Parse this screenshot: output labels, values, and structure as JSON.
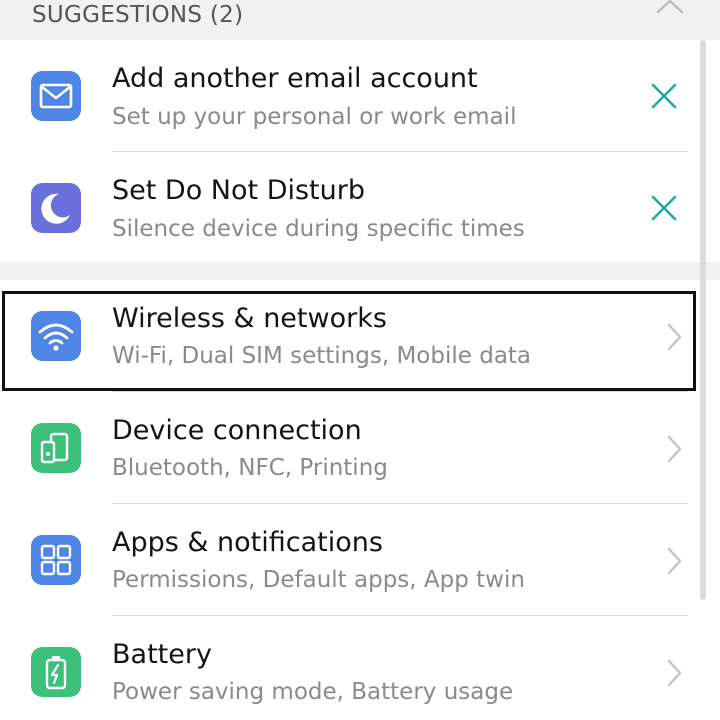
{
  "suggestions": {
    "header": "SUGGESTIONS (2)",
    "items": [
      {
        "title": "Add another email account",
        "subtitle": "Set up your personal or work email",
        "icon": "email-icon",
        "color": "#4f86e6"
      },
      {
        "title": "Set Do Not Disturb",
        "subtitle": "Silence device during specific times",
        "icon": "moon-icon",
        "color": "#6a6fdb"
      }
    ],
    "dismiss_color": "#26a6a6"
  },
  "settings": {
    "items": [
      {
        "title": "Wireless & networks",
        "subtitle": "Wi-Fi, Dual SIM settings, Mobile data",
        "icon": "wifi-icon",
        "color": "#4f86e6"
      },
      {
        "title": "Device connection",
        "subtitle": "Bluetooth, NFC, Printing",
        "icon": "device-connection-icon",
        "color": "#3dc07a"
      },
      {
        "title": "Apps & notifications",
        "subtitle": "Permissions, Default apps, App twin",
        "icon": "apps-grid-icon",
        "color": "#4f86e6"
      },
      {
        "title": "Battery",
        "subtitle": "Power saving mode, Battery usage",
        "icon": "battery-icon",
        "color": "#3dc07a"
      }
    ]
  }
}
